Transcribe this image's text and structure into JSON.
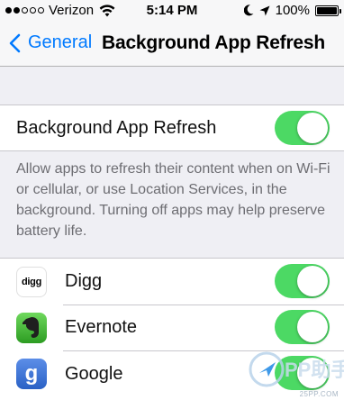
{
  "status_bar": {
    "carrier": "Verizon",
    "time": "5:14 PM",
    "battery": "100%",
    "signal_bars_filled": 2,
    "battery_level": 1.0
  },
  "nav": {
    "back_label": "General",
    "title": "Background App Refresh"
  },
  "main_toggle": {
    "label": "Background App Refresh",
    "on": true
  },
  "footer": "Allow apps to refresh their content when on Wi-Fi or cellular, or use Location Services, in the background. Turning off apps may help preserve battery life.",
  "apps": [
    {
      "name": "Digg",
      "icon_text": "digg",
      "icon": "digg-icon",
      "on": true
    },
    {
      "name": "Evernote",
      "icon": "evernote-icon",
      "on": true
    },
    {
      "name": "Google",
      "icon_text": "g",
      "icon": "google-icon",
      "on": true
    }
  ],
  "colors": {
    "accent": "#007aff",
    "toggle_on": "#4cd964",
    "background": "#efeff4",
    "footer_text": "#6d6d72"
  },
  "watermark": {
    "text": "PP助手",
    "domain": "25PP.COM"
  }
}
